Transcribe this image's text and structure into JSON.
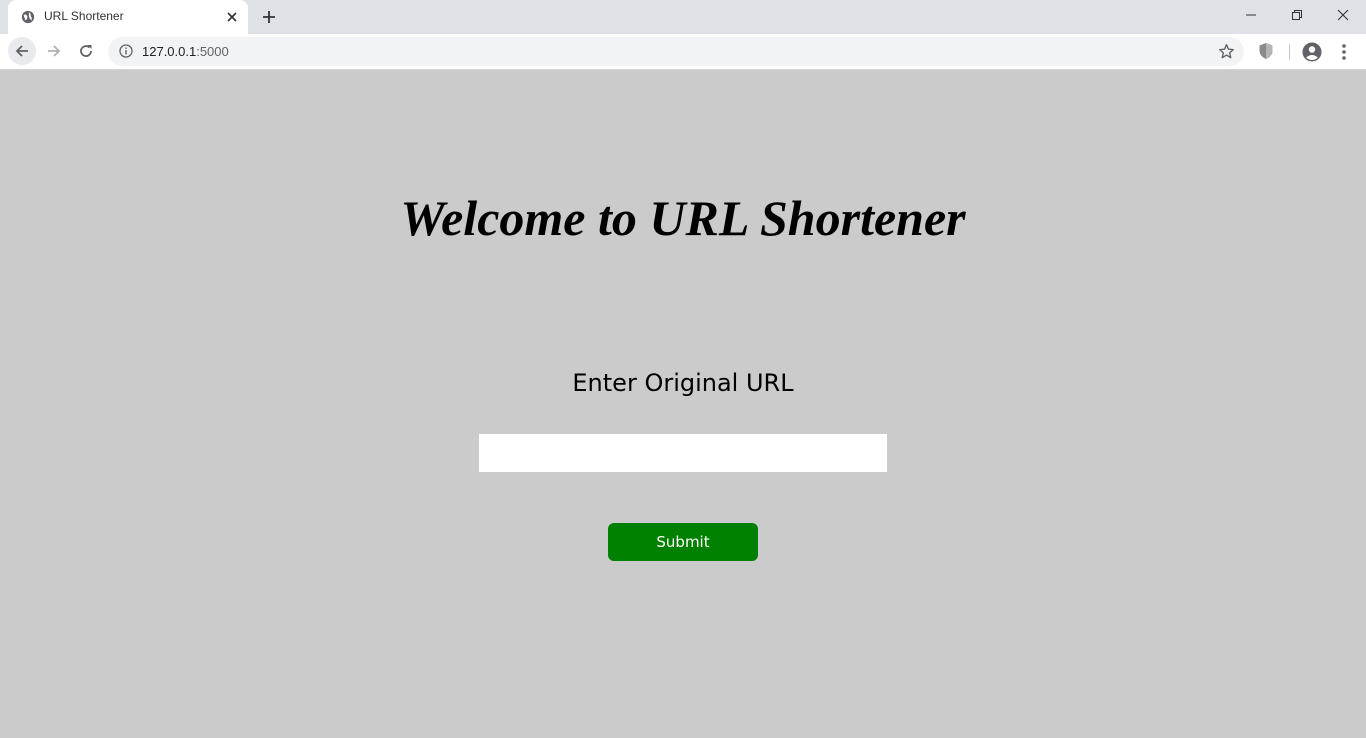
{
  "browser": {
    "tab": {
      "title": "URL Shortener",
      "favicon": "globe-icon"
    },
    "address_bar": {
      "host": "127.0.0.1",
      "port": ":5000"
    },
    "icons": {
      "back": "arrow-left-icon",
      "forward": "arrow-right-icon",
      "reload": "reload-icon",
      "info": "info-icon",
      "bookmark": "star-icon",
      "extension": "shield-icon",
      "profile": "account-icon",
      "menu": "kebab-menu-icon"
    }
  },
  "page": {
    "heading": "Welcome to URL Shortener",
    "form": {
      "label": "Enter Original URL",
      "input_value": "",
      "submit_label": "Submit"
    }
  },
  "colors": {
    "page_background": "#cbcbcb",
    "submit_button": "#008000",
    "submit_text": "#ffffff"
  }
}
